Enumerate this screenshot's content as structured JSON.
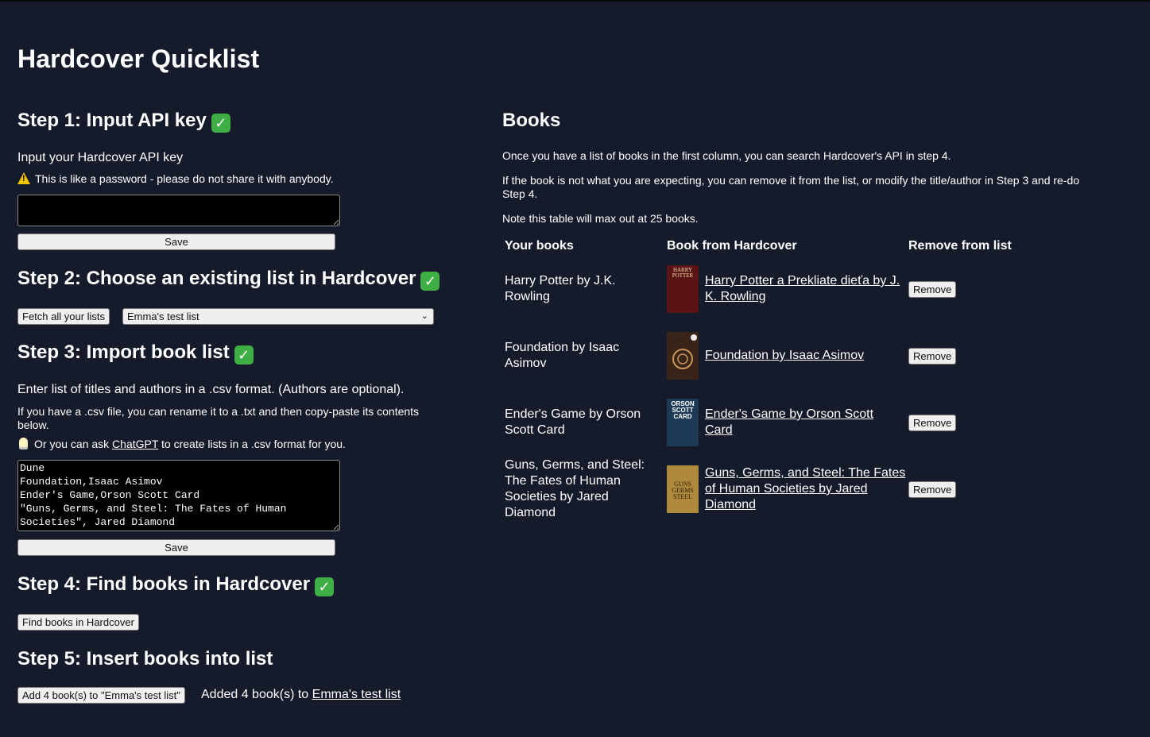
{
  "app": {
    "title": "Hardcover Quicklist"
  },
  "step1": {
    "heading": "Step 1: Input API key",
    "check": "✓",
    "label": "Input your Hardcover API key",
    "warning": "This is like a password - please do not share it with anybody.",
    "api_key_value": "",
    "save_label": "Save"
  },
  "step2": {
    "heading": "Step 2: Choose an existing list in Hardcover",
    "check": "✓",
    "fetch_label": "Fetch all your lists",
    "selected_list": "Emma's test list"
  },
  "step3": {
    "heading": "Step 3: Import book list",
    "check": "✓",
    "intro": "Enter list of titles and authors in a .csv format. (Authors are optional).",
    "hint_line1": "If you have a .csv file, you can rename it to a .txt and then copy-paste its contents",
    "hint_line2": "below.",
    "chatgpt_prefix": "Or you can ask",
    "chatgpt_link": "ChatGPT",
    "chatgpt_suffix": "to create lists in a .csv format for you.",
    "csv_text": "Dune\nFoundation,Isaac Asimov\nEnder's Game,Orson Scott Card\n\"Guns, Germs, and Steel: The Fates of Human\nSocieties\", Jared Diamond",
    "save_label": "Save"
  },
  "step4": {
    "heading": "Step 4: Find books in Hardcover",
    "check": "✓",
    "find_label": "Find books in Hardcover"
  },
  "step5": {
    "heading": "Step 5: Insert books into list",
    "add_label": "Add 4 book(s) to \"Emma's test list\"",
    "result_prefix": "Added 4 book(s) to",
    "result_link": "Emma's test list"
  },
  "books": {
    "heading": "Books",
    "para1": "Once you have a list of books in the first column, you can search Hardcover's API in step 4.",
    "para2_line1": "If the book is not what you are expecting, you can remove it from the list, or modify the title/author in Step 3 and re-do",
    "para2_line2": "Step 4.",
    "para3": "Note this table will max out at 25 books.",
    "columns": [
      "Your books",
      "Book from Hardcover",
      "Remove from list"
    ],
    "rows": [
      {
        "yours": [
          "Harry Potter by J.K.",
          "Rowling"
        ],
        "match": [
          "Harry Potter a Prekliate dieťa by J.",
          "K. Rowling"
        ],
        "remove": "Remove",
        "cover_text": "HARRY POTTER",
        "cover_color": "#5a1414"
      },
      {
        "yours": [
          "Foundation by Isaac",
          "Asimov"
        ],
        "match": [
          "Foundation by Isaac Asimov"
        ],
        "remove": "Remove",
        "cover_text": "",
        "cover_color": "#3a2418"
      },
      {
        "yours": [
          "Ender's Game by Orson",
          "Scott Card"
        ],
        "match": [
          "Ender's Game by Orson Scott",
          "Card"
        ],
        "remove": "Remove",
        "cover_text": "ORSON SCOTT CARD",
        "cover_color": "#1c3a55"
      },
      {
        "yours": [
          "Guns, Germs, and Steel:",
          "The Fates of Human",
          "Societies by Jared",
          "Diamond"
        ],
        "match": [
          "Guns, Germs, and Steel: The Fates",
          "of Human Societies by Jared",
          "Diamond"
        ],
        "remove": "Remove",
        "cover_text": "GUNS GERMS STEEL",
        "cover_color": "#b08a3c"
      }
    ]
  },
  "colors": {
    "background": "#161b2b",
    "check_green": "#3fae45",
    "warning_yellow": "#f2c500"
  }
}
